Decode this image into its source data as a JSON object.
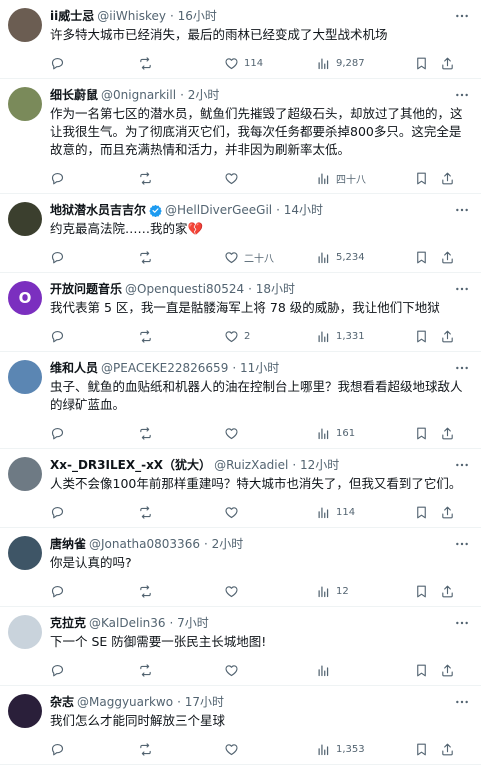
{
  "tweets": [
    {
      "name": "ii威士忌",
      "handle": "@iiWhiskey",
      "time": "· 16小时",
      "verified": false,
      "text": "许多特大城市已经消失，最后的雨林已经变成了大型战术机场",
      "likes": "114",
      "views": "9,287",
      "avatar_color": "#6b5d52"
    },
    {
      "name": "细长蔚鼠",
      "handle": "@0nignarkill",
      "time": "· 2小时",
      "verified": false,
      "text": "作为一名第七区的潜水员，鱿鱼们先摧毁了超级石头，却放过了其他的，这让我很生气。为了彻底消灭它们，我每次任务都要杀掉800多只。这完全是故意的，而且充满热情和活力，并非因为刷新率太低。",
      "likes": "",
      "views": "四十八",
      "avatar_color": "#7a8a5a"
    },
    {
      "name": "地狱潜水员吉吉尔",
      "handle": "@HellDiverGeeGil",
      "time": "· 14小时",
      "verified": true,
      "text": "约克最高法院……我的家💔",
      "likes": "二十八",
      "views": "5,234",
      "avatar_color": "#3b3f2e"
    },
    {
      "name": "开放问题音乐",
      "handle": "@Openquesti80524",
      "time": "· 18小时",
      "verified": false,
      "text": "我代表第 5 区，我一直是骷髅海军上将 78 级的威胁，我让他们下地狱",
      "likes": "2",
      "views": "1,331",
      "avatar_letter": "O",
      "avatar_color": "#7b2fbf"
    },
    {
      "name": "维和人员",
      "handle": "@PEACEKE22826659",
      "time": "· 11小时",
      "verified": false,
      "text": "虫子、鱿鱼的血贴纸和机器人的油在控制台上哪里？我想看看超级地球敌人的绿矿蓝血。",
      "likes": "",
      "views": "161",
      "avatar_color": "#5b86b3"
    },
    {
      "name": "Xx-_DR3ILEX_-xX（犹大）",
      "handle": "@RuizXadiel",
      "time": "· 12小时",
      "verified": false,
      "text": "人类不会像100年前那样重建吗？特大城市也消失了，但我又看到了它们。",
      "likes": "",
      "views": "114",
      "avatar_color": "#6e7a84"
    },
    {
      "name": "唐纳雀",
      "handle": "@Jonatha0803366",
      "time": "· 2小时",
      "verified": false,
      "text": "你是认真的吗?",
      "likes": "",
      "views": "12",
      "avatar_color": "#3e5566"
    },
    {
      "name": "克拉克",
      "handle": "@KalDelin36",
      "time": "· 7小时",
      "verified": false,
      "text": "下一个 SE 防御需要一张民主长城地图!",
      "likes": "",
      "views": "",
      "avatar_color": "#c9d3dc"
    },
    {
      "name": "杂志",
      "handle": "@Maggyuarkwo",
      "time": "· 17小时",
      "verified": false,
      "text": "我们怎么才能同时解放三个星球",
      "likes": "",
      "views": "1,353",
      "avatar_color": "#2a1f3a"
    }
  ],
  "icons": {
    "more": "more-icon",
    "reply": "reply-icon",
    "retweet": "retweet-icon",
    "like": "heart-icon",
    "views": "views-icon",
    "bookmark": "bookmark-icon",
    "share": "share-icon",
    "verified": "verified-badge-icon"
  },
  "colors": {
    "text": "#0f1419",
    "secondary": "#536471",
    "verified": "#1d9bf0",
    "divider": "#eff3f4"
  }
}
